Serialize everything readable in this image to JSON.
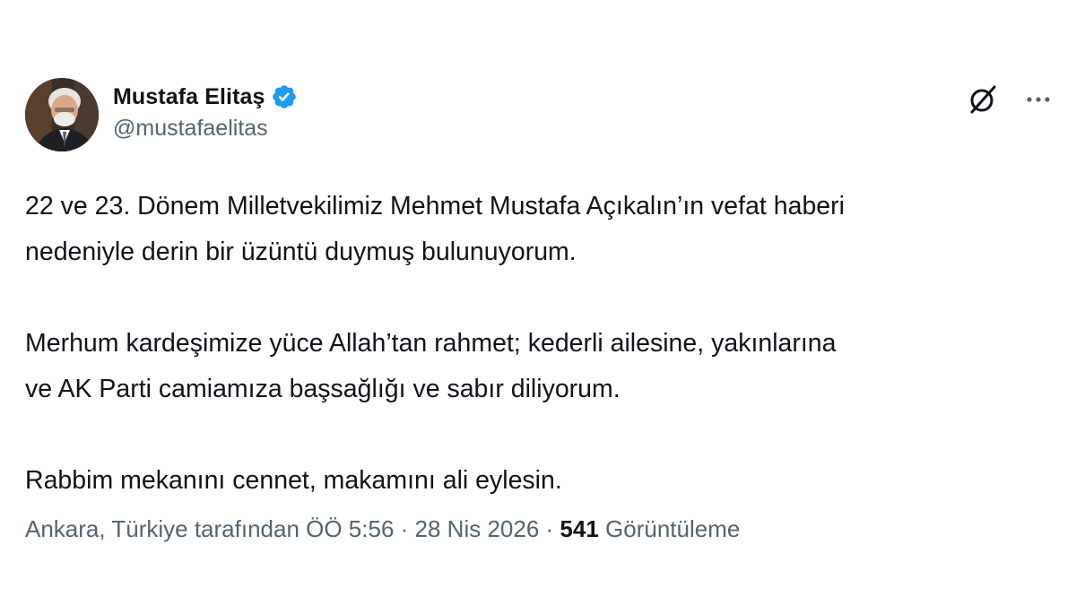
{
  "author": {
    "display_name": "Mustafa Elitaş",
    "handle": "@mustafaelitas",
    "verified_icon": "verified-badge-icon",
    "verified_color": "#1d9bf0"
  },
  "actions": {
    "grok_icon": "grok-icon",
    "more_icon": "more-options-icon"
  },
  "tweet": {
    "paragraphs": [
      "22 ve 23. Dönem Milletvekilimiz Mehmet Mustafa Açıkalın’ın vefat haberi\nnedeniyle derin bir üzüntü duymuş bulunuyorum.",
      "Merhum kardeşimize yüce Allah’tan rahmet; kederli ailesine, yakınlarına\nve AK Parti camiamıza başsağlığı ve sabır diliyorum.",
      "Rabbim mekanını cennet, makamını ali eylesin."
    ]
  },
  "meta": {
    "location": "Ankara, Türkiye tarafından",
    "time": "ÖÖ 5:56",
    "separator": " · ",
    "date": "28 Nis 2026",
    "views_count": "541",
    "views_label": "Görüntüleme"
  },
  "colors": {
    "text_primary": "#0f1419",
    "text_secondary": "#536471",
    "background": "#ffffff"
  }
}
